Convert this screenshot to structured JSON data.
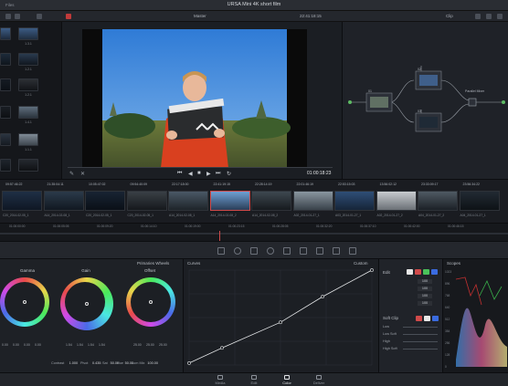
{
  "window": {
    "title": "URSA Mini 4K short film",
    "menu_label": "Files"
  },
  "viewer_header": {
    "timeline_name": "Master",
    "timecode": "22:41:18:15",
    "clip_label": "Clip"
  },
  "gallery": {
    "labels": [
      "1.3.1",
      "1.2.1",
      "1.2.1",
      "1.4.1",
      "1.1.1"
    ]
  },
  "viewer": {
    "timecode": "01:00:18:23"
  },
  "nodes": {
    "labels": [
      "01",
      "02",
      "03",
      "04"
    ],
    "output_label": "Parallel Mixer"
  },
  "clips": [
    {
      "tc": "09:57:46:22",
      "track": "V1",
      "name": "C20_2014-02-05_1"
    },
    {
      "tc": "21:35:04:11",
      "track": "V1",
      "name": "A14_2014-02-08_1"
    },
    {
      "tc": "10:05:47:02",
      "track": "V1",
      "name": "C20_2014-02-05_1"
    },
    {
      "tc": "09:54:40:09",
      "track": "V1",
      "name": "C20_2014-02-05_1"
    },
    {
      "tc": "22:17:18:00",
      "track": "V1",
      "name": "A14_2014-02-08_1"
    },
    {
      "tc": "22:41:19:15",
      "track": "V1",
      "name": "A14_2014-02-08_2"
    },
    {
      "tc": "22:28:14:19",
      "track": "V1",
      "name": "A14_2014-02-08_2"
    },
    {
      "tc": "22:01:46:19",
      "track": "V1",
      "name": "A02_2014-01-27_1"
    },
    {
      "tc": "22:53:15:03",
      "track": "V1",
      "name": "A03_2014-01-27_1"
    },
    {
      "tc": "13:56:02:12",
      "track": "V1",
      "name": "A02_2014-01-27_2"
    },
    {
      "tc": "23:33:09:17",
      "track": "V1",
      "name": "A04_2014-01-27_2"
    },
    {
      "tc": "23:56:34:22",
      "track": "V1",
      "name": "A04_2014-01-27_1"
    }
  ],
  "mini_timeline": {
    "ticks": [
      "01:00:00:00",
      "01:00:05:05",
      "01:00:09:20",
      "01:00:14:10",
      "01:00:19:00",
      "01:00:23:15",
      "01:00:28:05",
      "01:00:32:20",
      "01:00:37:10",
      "01:00:42:00",
      "01:00:46:15"
    ]
  },
  "primaries": {
    "panel_title": "Primaries Wheels",
    "wheels": [
      {
        "label": "Gamma",
        "values": [
          "0.00",
          "0.00",
          "0.00",
          "0.00"
        ]
      },
      {
        "label": "Gain",
        "values": [
          "1.54",
          "1.54",
          "1.54",
          "1.54"
        ]
      },
      {
        "label": "Offset",
        "values": [
          "25.00",
          "25.00",
          "25.00"
        ]
      }
    ],
    "params": [
      {
        "label": "Contrast",
        "value": "1.000"
      },
      {
        "label": "Pivot",
        "value": "0.435"
      },
      {
        "label": "Sat",
        "value": "50.00"
      },
      {
        "label": "Hue",
        "value": "50.00"
      },
      {
        "label": "Lum Mix",
        "value": "100.00"
      }
    ]
  },
  "curves": {
    "panel_title": "Curves",
    "mode": "Custom",
    "points": [
      [
        0.0,
        0.02
      ],
      [
        0.18,
        0.18
      ],
      [
        0.5,
        0.45
      ],
      [
        0.73,
        0.72
      ],
      [
        1.0,
        1.0
      ]
    ]
  },
  "edit_panel": {
    "title": "Edit",
    "values": [
      "100",
      "100",
      "100",
      "100"
    ],
    "softclip_title": "Soft Clip",
    "softclip_labels": [
      "Low",
      "Low Soft",
      "High",
      "High Soft"
    ]
  },
  "scopes": {
    "title": "Scopes",
    "ticks": [
      "1023",
      "896",
      "768",
      "640",
      "512",
      "384",
      "256",
      "128",
      "0"
    ]
  },
  "nav": {
    "items": [
      {
        "label": "Media"
      },
      {
        "label": "Edit"
      },
      {
        "label": "Color"
      },
      {
        "label": "Deliver"
      }
    ]
  },
  "colors": {
    "accent_red": "#d04a4a",
    "ui_bg": "#1e2127"
  }
}
